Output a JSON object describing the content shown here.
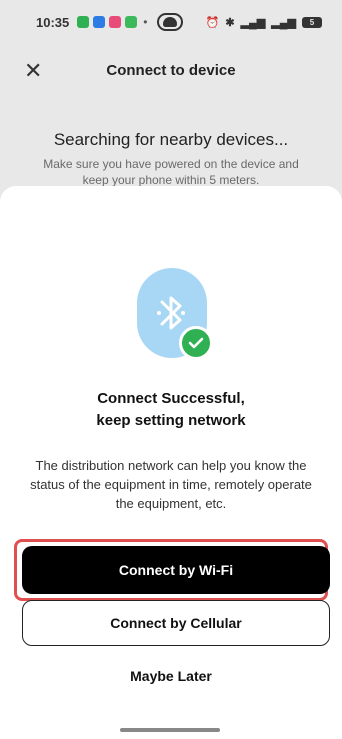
{
  "status_bar": {
    "time": "10:35",
    "signal_text_1": "⁵ᴳ",
    "signal_text_2": "⁵ᴳ",
    "battery": "5"
  },
  "header": {
    "title": "Connect to device"
  },
  "searching": {
    "title": "Searching for nearby devices...",
    "subtitle": "Make sure you have powered on the device and keep your phone within 5 meters."
  },
  "sheet": {
    "title_line1": "Connect Successful,",
    "title_line2": "keep setting network",
    "description": "The distribution network can help you know the status of the equipment in time, remotely operate the equipment, etc.",
    "wifi_button": "Connect by Wi-Fi",
    "cellular_button": "Connect by Cellular",
    "later_button": "Maybe Later"
  },
  "colors": {
    "bluetooth_bg": "#a8d6f5",
    "success_green": "#2fb052",
    "highlight_red": "#e05050"
  }
}
